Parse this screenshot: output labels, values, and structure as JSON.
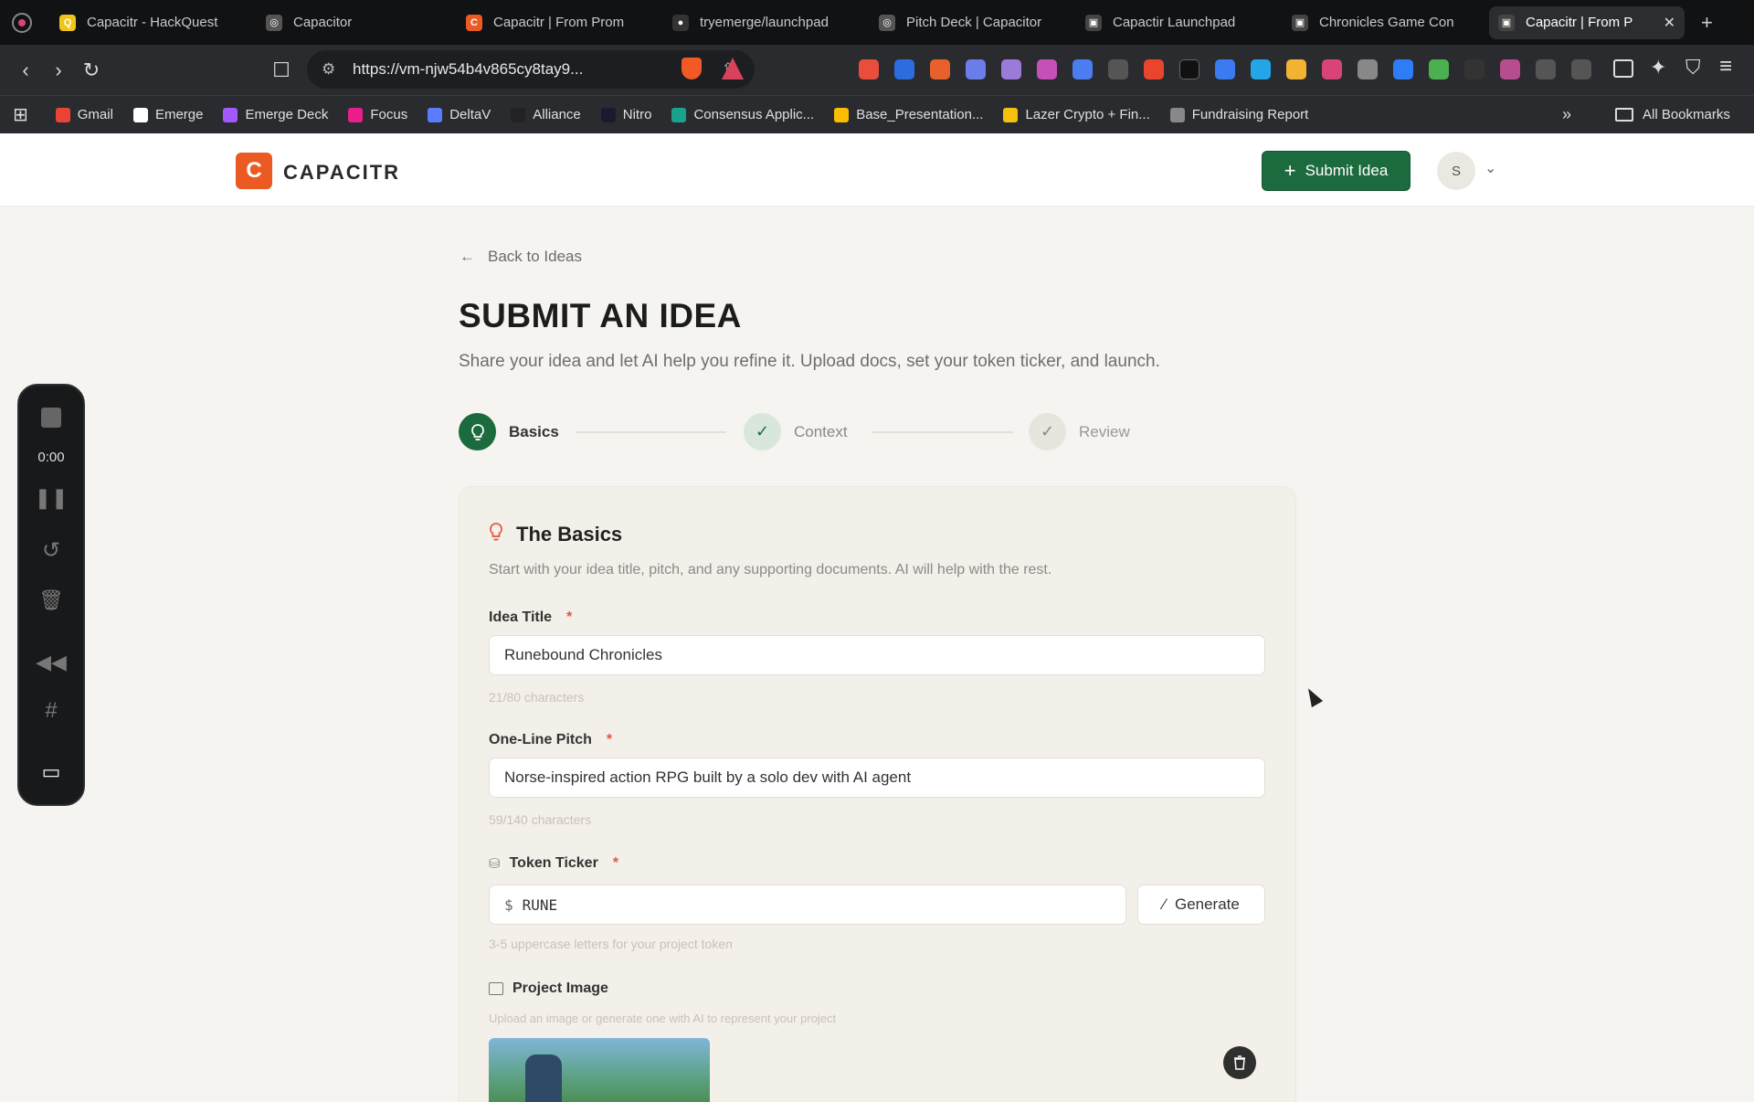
{
  "browser": {
    "tabs": [
      {
        "title": "Capacitr - HackQuest",
        "color": "#f0c419",
        "glyph": "Q"
      },
      {
        "title": "Capacitor",
        "color": "#555",
        "glyph": "◎"
      },
      {
        "title": "Capacitr | From Prom",
        "color": "#ec5a24",
        "glyph": "C"
      },
      {
        "title": "tryemerge/launchpad",
        "color": "#333",
        "glyph": "●"
      },
      {
        "title": "Pitch Deck | Capacitor",
        "color": "#555",
        "glyph": "◎"
      },
      {
        "title": "Capactir Launchpad",
        "color": "#444",
        "glyph": "▣"
      },
      {
        "title": "Chronicles Game Con",
        "color": "#444",
        "glyph": "▣"
      },
      {
        "title": "Capacitr | From P",
        "color": "#444",
        "glyph": "▣",
        "active": true
      }
    ],
    "url": "https://vm-njw54b4v865cy8tay9...",
    "bookmarks": [
      {
        "label": "Gmail",
        "color": "#ea4335"
      },
      {
        "label": "Emerge",
        "color": "#ffffff"
      },
      {
        "label": "Emerge Deck",
        "color": "#a259ff"
      },
      {
        "label": "Focus",
        "color": "#e91e8c"
      },
      {
        "label": "DeltaV",
        "color": "#5b7cff"
      },
      {
        "label": "Alliance",
        "color": "#222222"
      },
      {
        "label": "Nitro",
        "color": "#1a1a2e"
      },
      {
        "label": "Consensus Applic...",
        "color": "#1aa38c"
      },
      {
        "label": "Base_Presentation...",
        "color": "#fbbc04"
      },
      {
        "label": "Lazer Crypto + Fin...",
        "color": "#f4c20d"
      },
      {
        "label": "Fundraising Report",
        "color": "#888888"
      }
    ],
    "more_bookmarks": "»",
    "all_bookmarks": "All Bookmarks"
  },
  "header": {
    "logo_letter": "C",
    "logo_text": "CAPACITR",
    "submit_label": "Submit Idea",
    "avatar_initial": "S"
  },
  "page": {
    "back_label": "Back to Ideas",
    "title": "SUBMIT AN IDEA",
    "subtitle": "Share your idea and let AI help you refine it. Upload docs, set your token ticker, and launch."
  },
  "steps": [
    {
      "label": "Basics",
      "state": "active"
    },
    {
      "label": "Context",
      "state": "done"
    },
    {
      "label": "Review",
      "state": "done"
    }
  ],
  "form": {
    "section_title": "The Basics",
    "section_sub": "Start with your idea title, pitch, and any supporting documents. AI will help with the rest.",
    "title_label": "Idea Title",
    "title_value": "Runebound Chronicles",
    "title_hint": "21/80 characters",
    "pitch_label": "One-Line Pitch",
    "pitch_value": "Norse-inspired action RPG built by a solo dev with AI agent",
    "pitch_hint": "59/140 characters",
    "ticker_label": "Token Ticker",
    "ticker_prefix": "$",
    "ticker_value": "RUNE",
    "ticker_hint": "3-5 uppercase letters for your project token",
    "generate_label": "Generate",
    "image_label": "Project Image",
    "image_hint": "Upload an image or generate one with AI to represent your project",
    "required_mark": "*"
  },
  "recorder": {
    "timer": "0:00"
  },
  "colors": {
    "brand": "#ec5a24",
    "primary_green": "#1c6b3e"
  }
}
